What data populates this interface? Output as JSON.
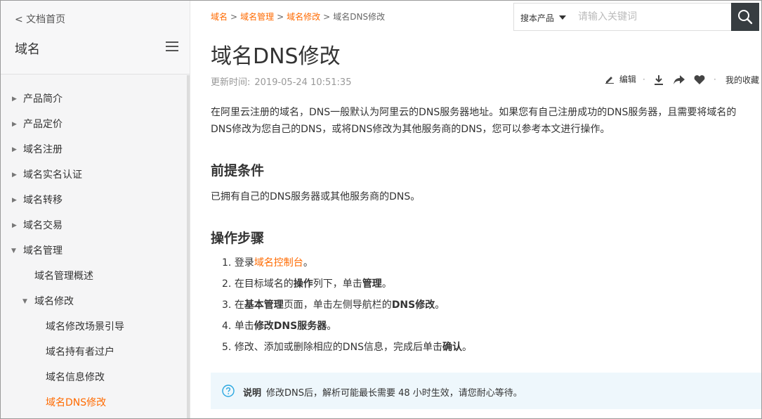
{
  "sidebar": {
    "back_label": "< 文档首页",
    "title": "域名",
    "items": [
      {
        "label": "产品简介",
        "expanded": false
      },
      {
        "label": "产品定价",
        "expanded": false
      },
      {
        "label": "域名注册",
        "expanded": false
      },
      {
        "label": "域名实名认证",
        "expanded": false
      },
      {
        "label": "域名转移",
        "expanded": false
      },
      {
        "label": "域名交易",
        "expanded": false
      },
      {
        "label": "域名管理",
        "expanded": true
      },
      {
        "label": "域名管理概述"
      },
      {
        "label": "域名修改",
        "expanded": true
      },
      {
        "label": "域名修改场景引导"
      },
      {
        "label": "域名持有者过户"
      },
      {
        "label": "域名信息修改"
      },
      {
        "label": "域名DNS修改",
        "active": true
      }
    ]
  },
  "breadcrumb": {
    "items": [
      "域名",
      "域名管理",
      "域名修改",
      "域名DNS修改"
    ],
    "separator": ">"
  },
  "search": {
    "scope_label": "搜本产品",
    "placeholder": "请输入关键词"
  },
  "article": {
    "title": "域名DNS修改",
    "update_label": "更新时间:",
    "update_time": "2019-05-24 10:51:35",
    "actions": {
      "edit": "编辑",
      "favorite": "我的收藏"
    },
    "intro": "在阿里云注册的域名，DNS一般默认为阿里云的DNS服务器地址。如果您有自己注册成功的DNS服务器，且需要将域名的DNS修改为您自己的DNS，或将DNS修改为其他服务商的DNS，您可以参考本文进行操作。",
    "prereq_heading": "前提条件",
    "prereq_text": "已拥有自己的DNS服务器或其他服务商的DNS。",
    "steps_heading": "操作步骤",
    "steps": {
      "s1_num": "1.",
      "s1_pre": "登录",
      "s1_link": "域名控制台",
      "s1_post": "。",
      "s2_num": "2.",
      "s2_pre": "在目标域名的",
      "s2_b1": "操作",
      "s2_mid": "列下，单击",
      "s2_b2": "管理",
      "s2_post": "。",
      "s3_num": "3.",
      "s3_pre": "在",
      "s3_b1": "基本管理",
      "s3_mid": "页面，单击左侧导航栏的",
      "s3_b2": "DNS修改",
      "s3_post": "。",
      "s4_num": "4.",
      "s4_pre": "单击",
      "s4_b1": "修改DNS服务器",
      "s4_post": "。",
      "s5_num": "5.",
      "s5_pre": "修改、添加或删除相应的DNS信息，完成后单击",
      "s5_b1": "确认",
      "s5_post": "。"
    },
    "note": {
      "label": "说明",
      "text": "修改DNS后，解析可能最长需要 48 小时生效，请您耐心等待。"
    }
  },
  "colors": {
    "accent": "#ff6a00",
    "note_bg": "#eef7fc",
    "note_icon": "#2aa7e0",
    "search_btn": "#373d41"
  },
  "icons": [
    "chevron-right-icon",
    "chevron-down-icon",
    "hamburger-menu-icon",
    "search-icon",
    "edit-pen-icon",
    "download-icon",
    "share-icon",
    "heart-icon",
    "question-circle-icon",
    "caret-down-icon"
  ]
}
